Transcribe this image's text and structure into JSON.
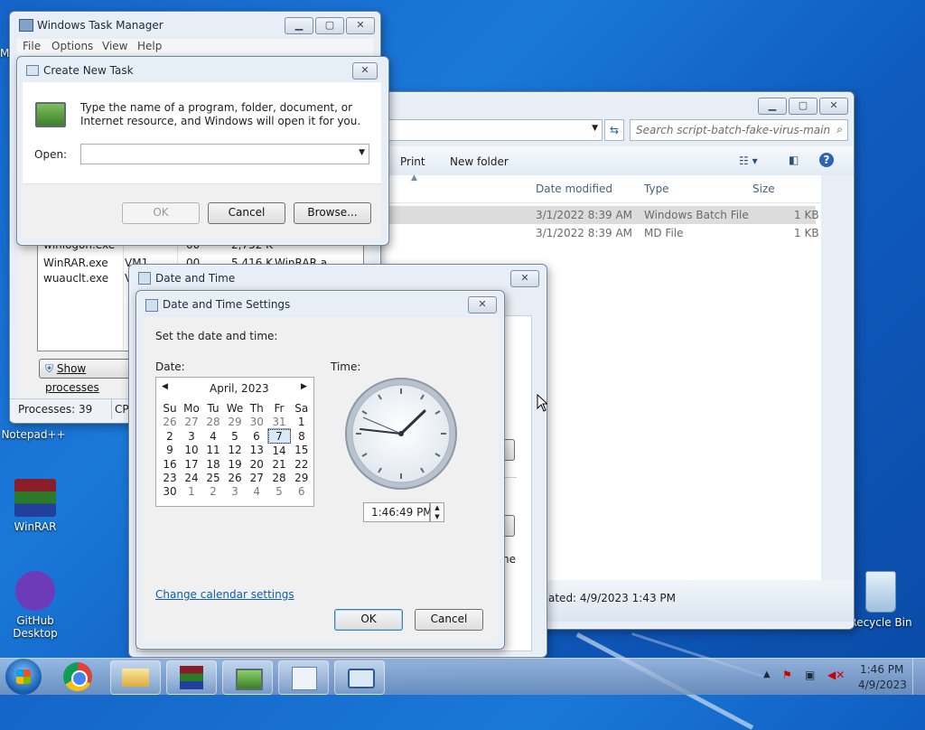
{
  "desktop": {
    "icons": [
      {
        "label": "Notepad++"
      },
      {
        "label": "WinRAR"
      },
      {
        "label": "GitHub Desktop"
      },
      {
        "label": "Recycle Bin"
      }
    ],
    "cut_label_left": "M"
  },
  "task_manager": {
    "title": "Windows Task Manager",
    "menu": [
      "File",
      "Options",
      "View",
      "Help"
    ],
    "processes": [
      {
        "name": "winlogon.exe",
        "user": "",
        "cpu": "00",
        "mem": "2,752 K",
        "desc": ""
      },
      {
        "name": "WinRAR.exe",
        "user": "VM1",
        "cpu": "00",
        "mem": "5,416 K",
        "desc": "WinRAR a..."
      },
      {
        "name": "wuauclt.exe",
        "user": "V",
        "cpu": "",
        "mem": "",
        "desc": ""
      }
    ],
    "show_processes_label": "Show processes",
    "status_processes": "Processes: 39",
    "status_cpu": "CP"
  },
  "run_dialog": {
    "title": "Create New Task",
    "description": "Type the name of a program, folder, document, or Internet resource, and Windows will open it for you.",
    "open_label": "Open:",
    "open_value": "",
    "ok_label": "OK",
    "cancel_label": "Cancel",
    "browse_label": "Browse..."
  },
  "explorer": {
    "search_placeholder": "Search script-batch-fake-virus-main",
    "toolbar": {
      "print": "Print",
      "new_folder": "New folder"
    },
    "columns": {
      "date": "Date modified",
      "type": "Type",
      "size": "Size"
    },
    "files": [
      {
        "date": "3/1/2022 8:39 AM",
        "type": "Windows Batch File",
        "size": "1 KB"
      },
      {
        "date": "3/1/2022 8:39 AM",
        "type": "MD File",
        "size": "1 KB"
      }
    ],
    "details_created": "ated:  4/9/2023 1:43 PM"
  },
  "date_time_outer": {
    "title": "Date and Time",
    "cut_text": "ne"
  },
  "date_time_settings": {
    "title": "Date and Time Settings",
    "instruction": "Set the date and time:",
    "date_label": "Date:",
    "time_label": "Time:",
    "month_label": "April, 2023",
    "weekdays": [
      "Su",
      "Mo",
      "Tu",
      "We",
      "Th",
      "Fr",
      "Sa"
    ],
    "weeks": [
      [
        "26",
        "27",
        "28",
        "29",
        "30",
        "31",
        "1"
      ],
      [
        "2",
        "3",
        "4",
        "5",
        "6",
        "7",
        "8"
      ],
      [
        "9",
        "10",
        "11",
        "12",
        "13",
        "14",
        "15"
      ],
      [
        "16",
        "17",
        "18",
        "19",
        "20",
        "21",
        "22"
      ],
      [
        "23",
        "24",
        "25",
        "26",
        "27",
        "28",
        "29"
      ],
      [
        "30",
        "1",
        "2",
        "3",
        "4",
        "5",
        "6"
      ]
    ],
    "selected_day": "7",
    "time_value": "1:46:49 PM",
    "change_calendar_link": "Change calendar settings",
    "ok_label": "OK",
    "cancel_label": "Cancel"
  },
  "taskbar": {
    "clock_time": "1:46 PM",
    "clock_date": "4/9/2023"
  }
}
